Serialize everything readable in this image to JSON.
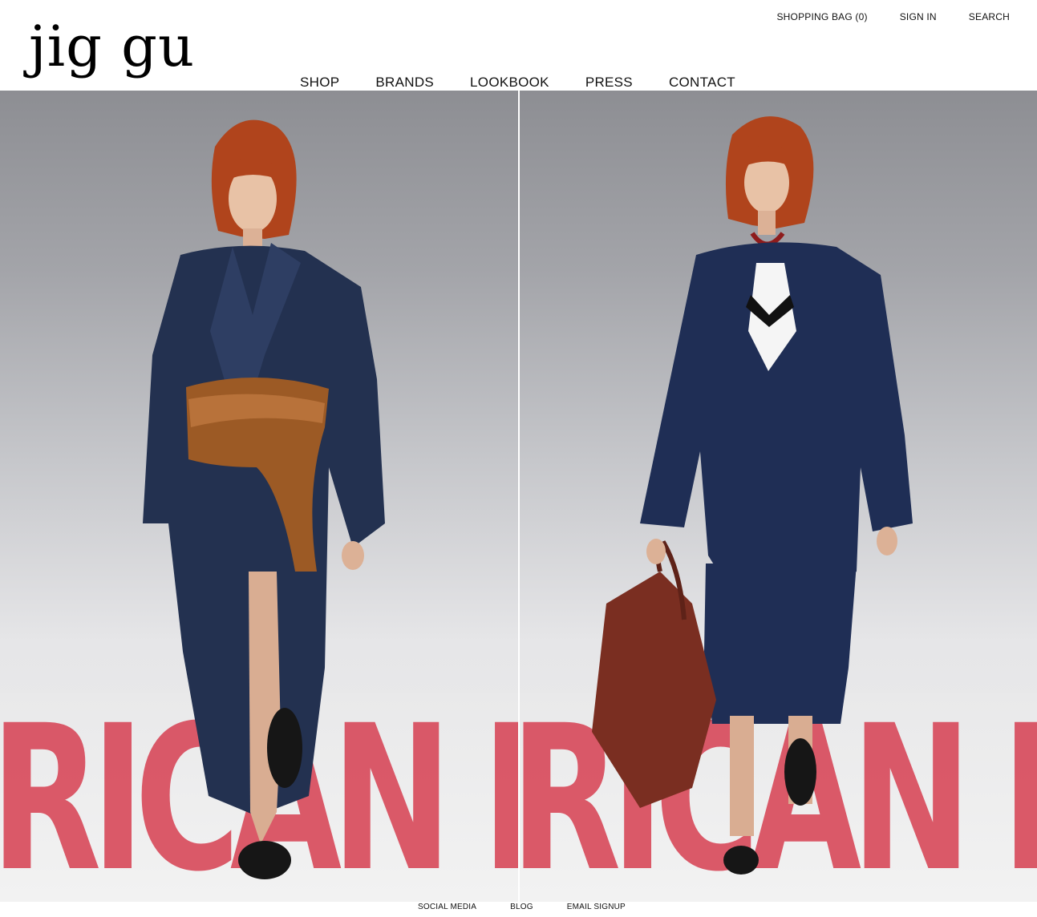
{
  "brand": {
    "logo_text": "jig gu"
  },
  "utility_nav": {
    "shopping_bag": "SHOPPING BAG (0)",
    "sign_in": "SIGN IN",
    "search": "SEARCH"
  },
  "main_nav": {
    "shop": "SHOP",
    "brands": "BRANDS",
    "lookbook": "LOOKBOOK",
    "press": "PRESS",
    "contact": "CONTACT"
  },
  "hero": {
    "left_floor_text": "RICAN DR",
    "right_floor_text": "RICAN DR"
  },
  "footer": {
    "social_media": "SOCIAL MEDIA",
    "blog": "BLOG",
    "email_signup": "EMAIL SIGNUP"
  }
}
